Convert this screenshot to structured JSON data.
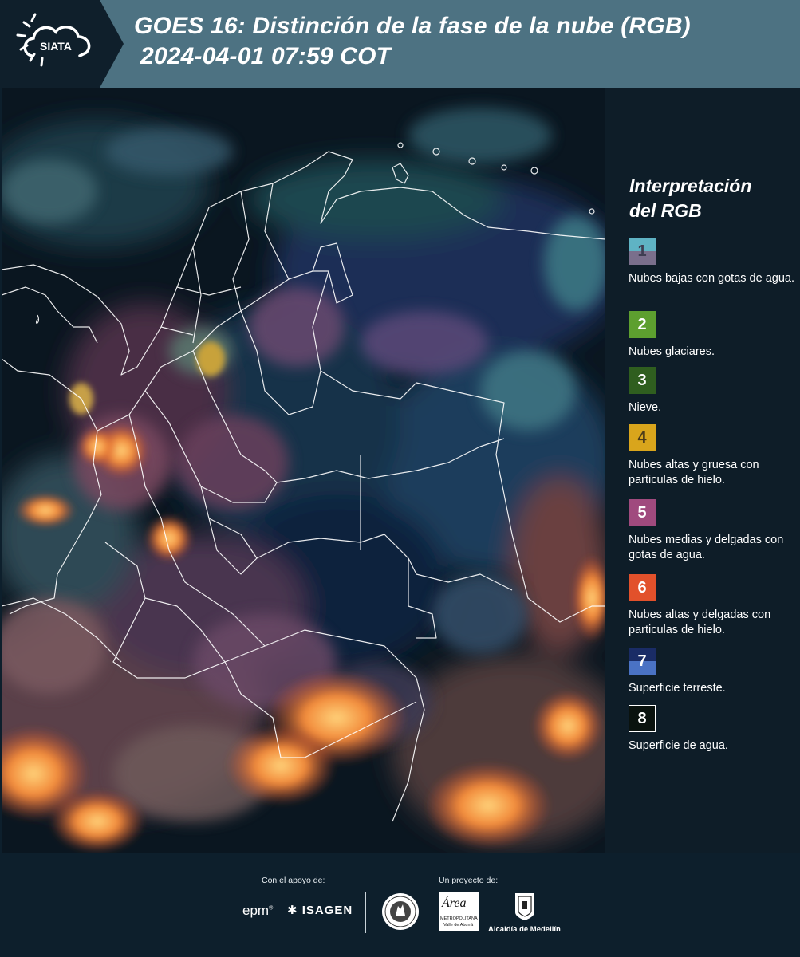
{
  "header": {
    "logo_text": "SIATA",
    "title_line1": "GOES 16: Distinción de la fase de la nube (RGB)",
    "title_line2": "2024-04-01 07:59 COT"
  },
  "legend": {
    "title_line1": "Interpretación",
    "title_line2": "del RGB",
    "items": [
      {
        "num": "1",
        "label": "Nubes bajas con gotas de agua.",
        "color_top": "#5fb3c4",
        "color_bottom": "#7a6f8c",
        "num_color": "#3e3e52"
      },
      {
        "num": "2",
        "label": "Nubes glaciares.",
        "color_top": "#5d9f2f",
        "color_bottom": "#5d9f2f",
        "num_color": "#ffffff"
      },
      {
        "num": "3",
        "label": "Nieve.",
        "color_top": "#2f5e1f",
        "color_bottom": "#2f5e1f",
        "num_color": "#ffffff"
      },
      {
        "num": "4",
        "label": "Nubes altas y gruesa con particulas de hielo.",
        "color_top": "#d9a51c",
        "color_bottom": "#d9a51c",
        "num_color": "#4a3a1a"
      },
      {
        "num": "5",
        "label": "Nubes medias y delgadas con gotas de agua.",
        "color_top": "#a04a7e",
        "color_bottom": "#a04a7e",
        "num_color": "#ffffff"
      },
      {
        "num": "6",
        "label": "Nubes altas y delgadas con particulas de hielo.",
        "color_top": "#e2512b",
        "color_bottom": "#e2512b",
        "num_color": "#ffffff"
      },
      {
        "num": "7",
        "label": "Superficie terreste.",
        "color_top": "#1a2c66",
        "color_bottom": "#4a72c4",
        "num_color": "#ffffff"
      },
      {
        "num": "8",
        "label": "Superficie de agua.",
        "color_top": "#0a120e",
        "color_bottom": "#0a120e",
        "num_color": "#ffffff"
      }
    ]
  },
  "footer": {
    "support_label": "Con el apoyo de:",
    "project_label": "Un proyecto de:",
    "sponsor_epm": "epm",
    "sponsor_isagen": "ISAGEN",
    "area_logo_text": "Área",
    "area_sub1": "METROPOLITANA",
    "area_sub2": "Valle de Aburrá",
    "alcaldia": "Alcaldía de Medellín"
  }
}
